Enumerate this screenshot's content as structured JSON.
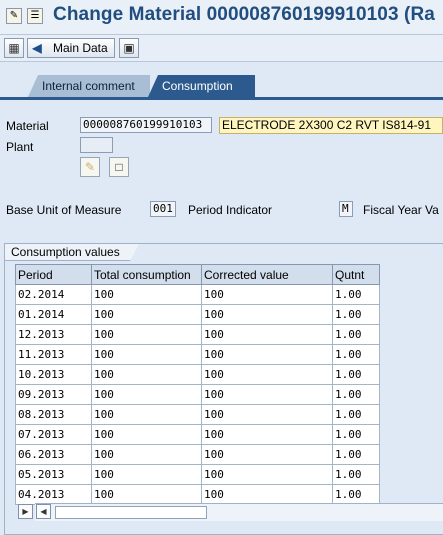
{
  "header": {
    "title": "Change Material 000008760199910103 (Ra"
  },
  "toolbar": {
    "main_data_label": "Main Data"
  },
  "tabs": [
    {
      "label": "Internal comment"
    },
    {
      "label": "Consumption"
    }
  ],
  "form": {
    "material_label": "Material",
    "material_number": "000008760199910103",
    "material_description": "ELECTRODE 2X300 C2 RVT IS814-91",
    "plant_label": "Plant",
    "plant_value": "",
    "base_uom_label": "Base Unit of Measure",
    "base_uom_value": "001",
    "period_indicator_label": "Period Indicator",
    "period_indicator_value": "M",
    "fiscal_year_label": "Fiscal Year Va"
  },
  "consumption": {
    "group_title": "Consumption values",
    "columns": [
      "Period",
      "Total consumption",
      "Corrected value",
      "Qutnt"
    ],
    "rows": [
      [
        "02.2014",
        "100",
        "100",
        "1.00"
      ],
      [
        "01.2014",
        "100",
        "100",
        "1.00"
      ],
      [
        "12.2013",
        "100",
        "100",
        "1.00"
      ],
      [
        "11.2013",
        "100",
        "100",
        "1.00"
      ],
      [
        "10.2013",
        "100",
        "100",
        "1.00"
      ],
      [
        "09.2013",
        "100",
        "100",
        "1.00"
      ],
      [
        "08.2013",
        "100",
        "100",
        "1.00"
      ],
      [
        "07.2013",
        "100",
        "100",
        "1.00"
      ],
      [
        "06.2013",
        "100",
        "100",
        "1.00"
      ],
      [
        "05.2013",
        "100",
        "100",
        "1.00"
      ],
      [
        "04.2013",
        "100",
        "100",
        "1.00"
      ]
    ]
  },
  "icons": {
    "titlebar": [
      "display-change-icon",
      "menu-icon"
    ],
    "toolbar": [
      "other-material-icon",
      "back-arrow-icon",
      "lock-icon"
    ],
    "form": [
      "attachment-icon",
      "document-icon"
    ],
    "scrollbar": [
      "scroll-left-icon",
      "scroll-right-icon"
    ]
  },
  "colors": {
    "title_text": "#214e7f",
    "active_tab": "#2c5a8e",
    "inactive_tab": "#a8bed4",
    "description_highlight": "#fff6bf",
    "background": "#dfe9f5"
  }
}
